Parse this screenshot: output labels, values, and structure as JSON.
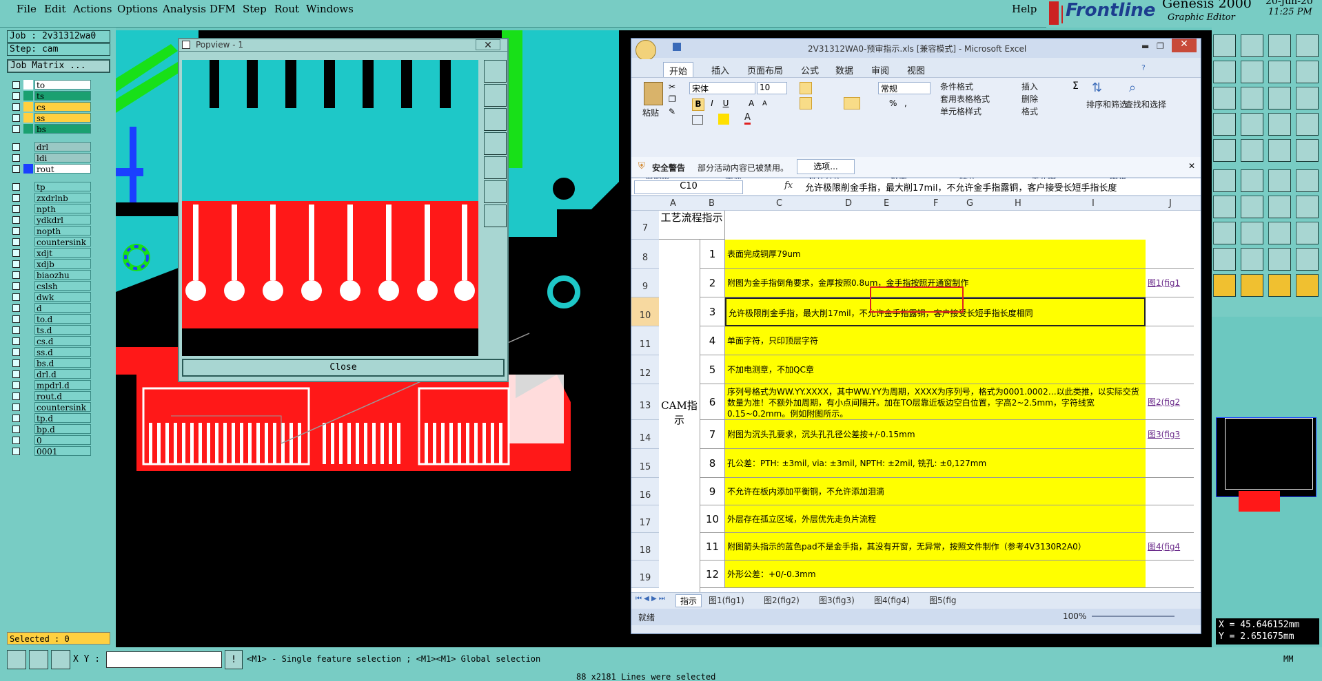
{
  "menu": {
    "file": "File",
    "edit": "Edit",
    "actions": "Actions",
    "options": "Options",
    "analysis": "Analysis",
    "dfm": "DFM",
    "step": "Step",
    "rout": "Rout",
    "windows": "Windows",
    "help": "Help"
  },
  "brand": {
    "logo": "Frontline",
    "product": "Genesis 2000",
    "subtitle": "Graphic Editor",
    "date": "20-Jun-20",
    "time": "11:25 PM"
  },
  "job": {
    "job_label": "Job : 2v31312wa0",
    "step_label": "Step: cam",
    "matrix_button": "Job Matrix ..."
  },
  "layers": [
    {
      "name": "to",
      "color": "#ffffff"
    },
    {
      "name": "ts",
      "color": "#1aa070"
    },
    {
      "name": "cs",
      "color": "#ffd040"
    },
    {
      "name": "ss",
      "color": "#ffd040"
    },
    {
      "name": "bs",
      "color": "#1aa070"
    },
    {
      "name": "drl",
      "color": "#9ac8c4"
    },
    {
      "name": "ldi",
      "color": "#9ac8c4"
    },
    {
      "name": "rout",
      "color": "#ffffff"
    },
    {
      "name": "tp",
      "color": "#7ed3cb"
    },
    {
      "name": "zxdrlnb",
      "color": "#7ed3cb"
    },
    {
      "name": "npth",
      "color": "#7ed3cb"
    },
    {
      "name": "ydkdrl",
      "color": "#7ed3cb"
    },
    {
      "name": "nopth",
      "color": "#7ed3cb"
    },
    {
      "name": "countersink",
      "color": "#7ed3cb"
    },
    {
      "name": "xdjt",
      "color": "#7ed3cb"
    },
    {
      "name": "xdjb",
      "color": "#7ed3cb"
    },
    {
      "name": "biaozhu",
      "color": "#7ed3cb"
    },
    {
      "name": "cslsh",
      "color": "#7ed3cb"
    },
    {
      "name": "dwk",
      "color": "#7ed3cb"
    },
    {
      "name": "d",
      "color": "#7ed3cb"
    },
    {
      "name": "to.d",
      "color": "#7ed3cb"
    },
    {
      "name": "ts.d",
      "color": "#7ed3cb"
    },
    {
      "name": "cs.d",
      "color": "#7ed3cb"
    },
    {
      "name": "ss.d",
      "color": "#7ed3cb"
    },
    {
      "name": "bs.d",
      "color": "#7ed3cb"
    },
    {
      "name": "drl.d",
      "color": "#7ed3cb"
    },
    {
      "name": "mpdrl.d",
      "color": "#7ed3cb"
    },
    {
      "name": "rout.d",
      "color": "#7ed3cb"
    },
    {
      "name": "countersink",
      "color": "#7ed3cb"
    },
    {
      "name": "tp.d",
      "color": "#7ed3cb"
    },
    {
      "name": "bp.d",
      "color": "#7ed3cb"
    },
    {
      "name": "0",
      "color": "#7ed3cb"
    },
    {
      "name": "0001",
      "color": "#7ed3cb"
    }
  ],
  "selected": "Selected : 0",
  "popview": {
    "title": "Popview - 1",
    "close_label": "Close"
  },
  "excel": {
    "title": "2V31312WA0-预审指示.xls [兼容模式] - Microsoft Excel",
    "tabs": [
      "开始",
      "插入",
      "页面布局",
      "公式",
      "数据",
      "审阅",
      "视图"
    ],
    "font_name": "宋体",
    "font_size": "10",
    "number_format": "常规",
    "paste": "粘贴",
    "styles": [
      "条件格式",
      "套用表格格式",
      "单元格样式"
    ],
    "cells_ops": [
      "插入",
      "删除",
      "格式"
    ],
    "sort_label": "排序和筛选",
    "find_label": "查找和选择",
    "groups": [
      "剪贴板",
      "字体",
      "对齐方式",
      "数字",
      "样式",
      "单元格",
      "编辑"
    ],
    "security_label": "安全警告",
    "security_msg": "部分活动内容已被禁用。",
    "options_btn": "选项...",
    "namebox": "C10",
    "formula": "允许极限削金手指，最大削17mil，不允许金手指露铜，客户接受长短手指长度",
    "columns": [
      "A",
      "B",
      "C",
      "D",
      "E",
      "F",
      "G",
      "H",
      "I",
      "J"
    ],
    "header_title": "工艺流程指示",
    "cam_label": "CAM指示",
    "rows": [
      {
        "r": "8",
        "n": "1",
        "text": "表面完成铜厚79um",
        "ref": ""
      },
      {
        "r": "9",
        "n": "2",
        "text": "附图为金手指倒角要求，金厚按照0.8um，金手指按照开通窗制作",
        "ref": "图1(fig1"
      },
      {
        "r": "10",
        "n": "3",
        "text": "允许极限削金手指，最大削17mil，不允许金手指露铜，客户接受长短手指长度相同",
        "ref": ""
      },
      {
        "r": "11",
        "n": "4",
        "text": "单面字符，只印顶层字符",
        "ref": ""
      },
      {
        "r": "12",
        "n": "5",
        "text": "不加电测章，不加QC章",
        "ref": ""
      },
      {
        "r": "13",
        "n": "6",
        "text": "序列号格式为WW.YY.XXXX，其中WW.YY为周期，XXXX为序列号，格式为0001.0002…以此类推，以实际交货数量为准！不额外加周期，有小点间隔开。加在TO层靠近板边空白位置，字高2~2.5mm，字符线宽0.15~0.2mm。例如附图所示。",
        "ref": "图2(fig2"
      },
      {
        "r": "14",
        "n": "7",
        "text": "附图为沉头孔要求，沉头孔孔径公差按+/-0.15mm",
        "ref": "图3(fig3"
      },
      {
        "r": "15",
        "n": "8",
        "text": "孔公差：PTH: ±3mil,  via: ±3mil,  NPTH: ±2mil,  铣孔: ±0,127mm",
        "ref": ""
      },
      {
        "r": "16",
        "n": "9",
        "text": "不允许在板内添加平衡铜，不允许添加泪滴",
        "ref": ""
      },
      {
        "r": "17",
        "n": "10",
        "text": "外层存在孤立区域，外层优先走负片流程",
        "ref": ""
      },
      {
        "r": "18",
        "n": "11",
        "text": "附图箭头指示的蓝色pad不是金手指，其没有开窗，无异常，按照文件制作（参考4V3130R2A0）",
        "ref": "图4(fig4"
      },
      {
        "r": "19",
        "n": "12",
        "text": "外形公差：+0/-0.3mm",
        "ref": ""
      }
    ],
    "row7": "7",
    "sheets": [
      "指示",
      "图1(fig1)",
      "图2(fig2)",
      "图3(fig3)",
      "图4(fig4)",
      "图5(fig"
    ],
    "status": "就绪",
    "zoom": "100%"
  },
  "coords": {
    "x": "X = 45.646152mm",
    "y": "Y = 2.651675mm"
  },
  "bottom": {
    "xy_label": "X Y :",
    "hint": "<M1> - Single feature selection ; <M1><M1> Global selection",
    "units": "MM",
    "status": "88 x2181 Lines were selected"
  }
}
